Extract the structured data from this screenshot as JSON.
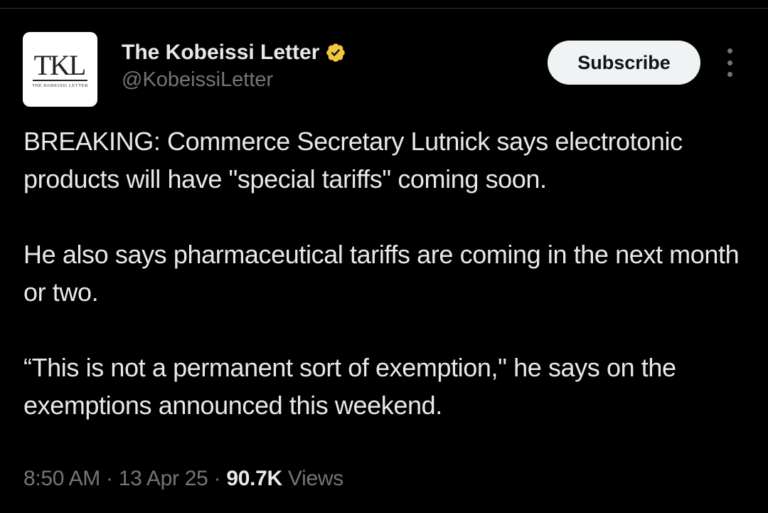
{
  "account": {
    "avatar_monogram": "TKL",
    "avatar_subtitle": "THE KOBEISSI LETTER",
    "display_name": "The Kobeissi Letter",
    "handle": "@KobeissiLetter",
    "verified_icon": "verified-badge-icon",
    "verified_color": "#f4c542"
  },
  "actions": {
    "subscribe_label": "Subscribe",
    "more_icon": "more-vertical-icon"
  },
  "tweet": {
    "paragraphs": [
      "BREAKING: Commerce Secretary Lutnick says electrotonic products will have \"special tariffs\" coming soon.",
      "He also says pharmaceutical tariffs are coming in the next month or two.",
      "“This is not a permanent sort of exemption,\" he says on the exemptions announced this weekend."
    ]
  },
  "meta": {
    "time": "8:50 AM",
    "date": "13 Apr 25",
    "separator": "·",
    "views_count": "90.7K",
    "views_label": "Views"
  }
}
